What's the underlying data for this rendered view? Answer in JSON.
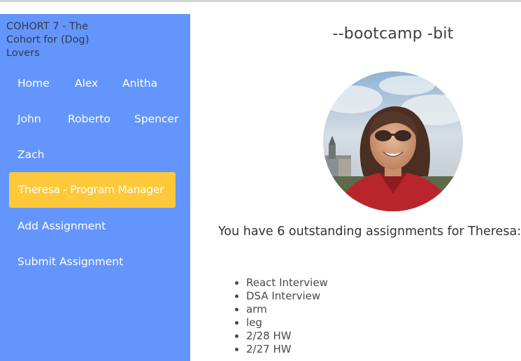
{
  "sidebar": {
    "brand": "COHORT 7 - The Cohort for (Dog) Lovers",
    "nav": {
      "home": "Home",
      "alex": "Alex",
      "anitha": "Anitha",
      "john": "John",
      "roberto": "Roberto",
      "spencer": "Spencer",
      "zach": "Zach",
      "theresa": "Theresa - Program Manager",
      "add_assignment": "Add Assignment",
      "submit_assignment": "Submit Assignment"
    },
    "active_item": "theresa"
  },
  "main": {
    "title": "--bootcamp -bit",
    "avatar_icon": "profile-photo",
    "status_text": "You have 6 outstanding assignments for Theresa:",
    "assignments": [
      "React Interview",
      "DSA Interview",
      "arm",
      "leg",
      "2/28 HW",
      "2/27 HW"
    ]
  },
  "colors": {
    "sidebar_bg": "#6495fc",
    "active_bg": "#fdc83a",
    "nav_text": "#ffffff"
  }
}
